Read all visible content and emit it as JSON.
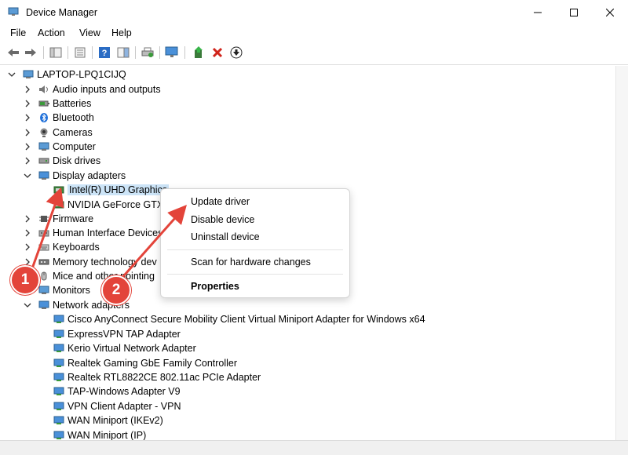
{
  "window": {
    "title": "Device Manager"
  },
  "menu": [
    "File",
    "Action",
    "View",
    "Help"
  ],
  "tree": {
    "root": "LAPTOP-LPQ1CIJQ",
    "categories_before": [
      "Audio inputs and outputs",
      "Batteries",
      "Bluetooth",
      "Cameras",
      "Computer",
      "Disk drives"
    ],
    "display_adapters": {
      "label": "Display adapters",
      "children": [
        "Intel(R) UHD Graphics",
        "NVIDIA GeForce GTX"
      ]
    },
    "categories_after": [
      "Firmware",
      "Human Interface Devices",
      "Keyboards",
      "Memory technology dev",
      "Mice and other pointing",
      "Monitors"
    ],
    "network_adapters": {
      "label": "Network adapters",
      "children": [
        "Cisco AnyConnect Secure Mobility Client Virtual Miniport Adapter for Windows x64",
        "ExpressVPN TAP Adapter",
        "Kerio Virtual Network Adapter",
        "Realtek Gaming GbE Family Controller",
        "Realtek RTL8822CE 802.11ac PCIe Adapter",
        "TAP-Windows Adapter V9",
        "VPN Client Adapter - VPN",
        "WAN Miniport (IKEv2)",
        "WAN Miniport (IP)"
      ]
    }
  },
  "context_menu": {
    "update": "Update driver",
    "disable": "Disable device",
    "uninstall": "Uninstall device",
    "scan": "Scan for hardware changes",
    "properties": "Properties"
  },
  "annotations": {
    "step1": "1",
    "step2": "2"
  },
  "colors": {
    "selection": "#cce4f7",
    "annotation": "#e3443a"
  },
  "icons": {
    "device": "monitor-icon",
    "network": "network-adapter-icon"
  }
}
